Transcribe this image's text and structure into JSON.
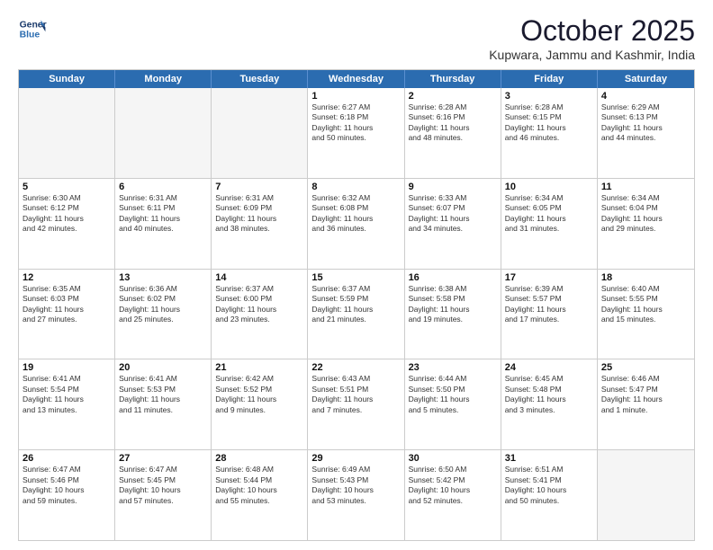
{
  "header": {
    "logo_line1": "General",
    "logo_line2": "Blue",
    "month": "October 2025",
    "location": "Kupwara, Jammu and Kashmir, India"
  },
  "weekdays": [
    "Sunday",
    "Monday",
    "Tuesday",
    "Wednesday",
    "Thursday",
    "Friday",
    "Saturday"
  ],
  "rows": [
    [
      {
        "day": "",
        "text": ""
      },
      {
        "day": "",
        "text": ""
      },
      {
        "day": "",
        "text": ""
      },
      {
        "day": "1",
        "text": "Sunrise: 6:27 AM\nSunset: 6:18 PM\nDaylight: 11 hours\nand 50 minutes."
      },
      {
        "day": "2",
        "text": "Sunrise: 6:28 AM\nSunset: 6:16 PM\nDaylight: 11 hours\nand 48 minutes."
      },
      {
        "day": "3",
        "text": "Sunrise: 6:28 AM\nSunset: 6:15 PM\nDaylight: 11 hours\nand 46 minutes."
      },
      {
        "day": "4",
        "text": "Sunrise: 6:29 AM\nSunset: 6:13 PM\nDaylight: 11 hours\nand 44 minutes."
      }
    ],
    [
      {
        "day": "5",
        "text": "Sunrise: 6:30 AM\nSunset: 6:12 PM\nDaylight: 11 hours\nand 42 minutes."
      },
      {
        "day": "6",
        "text": "Sunrise: 6:31 AM\nSunset: 6:11 PM\nDaylight: 11 hours\nand 40 minutes."
      },
      {
        "day": "7",
        "text": "Sunrise: 6:31 AM\nSunset: 6:09 PM\nDaylight: 11 hours\nand 38 minutes."
      },
      {
        "day": "8",
        "text": "Sunrise: 6:32 AM\nSunset: 6:08 PM\nDaylight: 11 hours\nand 36 minutes."
      },
      {
        "day": "9",
        "text": "Sunrise: 6:33 AM\nSunset: 6:07 PM\nDaylight: 11 hours\nand 34 minutes."
      },
      {
        "day": "10",
        "text": "Sunrise: 6:34 AM\nSunset: 6:05 PM\nDaylight: 11 hours\nand 31 minutes."
      },
      {
        "day": "11",
        "text": "Sunrise: 6:34 AM\nSunset: 6:04 PM\nDaylight: 11 hours\nand 29 minutes."
      }
    ],
    [
      {
        "day": "12",
        "text": "Sunrise: 6:35 AM\nSunset: 6:03 PM\nDaylight: 11 hours\nand 27 minutes."
      },
      {
        "day": "13",
        "text": "Sunrise: 6:36 AM\nSunset: 6:02 PM\nDaylight: 11 hours\nand 25 minutes."
      },
      {
        "day": "14",
        "text": "Sunrise: 6:37 AM\nSunset: 6:00 PM\nDaylight: 11 hours\nand 23 minutes."
      },
      {
        "day": "15",
        "text": "Sunrise: 6:37 AM\nSunset: 5:59 PM\nDaylight: 11 hours\nand 21 minutes."
      },
      {
        "day": "16",
        "text": "Sunrise: 6:38 AM\nSunset: 5:58 PM\nDaylight: 11 hours\nand 19 minutes."
      },
      {
        "day": "17",
        "text": "Sunrise: 6:39 AM\nSunset: 5:57 PM\nDaylight: 11 hours\nand 17 minutes."
      },
      {
        "day": "18",
        "text": "Sunrise: 6:40 AM\nSunset: 5:55 PM\nDaylight: 11 hours\nand 15 minutes."
      }
    ],
    [
      {
        "day": "19",
        "text": "Sunrise: 6:41 AM\nSunset: 5:54 PM\nDaylight: 11 hours\nand 13 minutes."
      },
      {
        "day": "20",
        "text": "Sunrise: 6:41 AM\nSunset: 5:53 PM\nDaylight: 11 hours\nand 11 minutes."
      },
      {
        "day": "21",
        "text": "Sunrise: 6:42 AM\nSunset: 5:52 PM\nDaylight: 11 hours\nand 9 minutes."
      },
      {
        "day": "22",
        "text": "Sunrise: 6:43 AM\nSunset: 5:51 PM\nDaylight: 11 hours\nand 7 minutes."
      },
      {
        "day": "23",
        "text": "Sunrise: 6:44 AM\nSunset: 5:50 PM\nDaylight: 11 hours\nand 5 minutes."
      },
      {
        "day": "24",
        "text": "Sunrise: 6:45 AM\nSunset: 5:48 PM\nDaylight: 11 hours\nand 3 minutes."
      },
      {
        "day": "25",
        "text": "Sunrise: 6:46 AM\nSunset: 5:47 PM\nDaylight: 11 hours\nand 1 minute."
      }
    ],
    [
      {
        "day": "26",
        "text": "Sunrise: 6:47 AM\nSunset: 5:46 PM\nDaylight: 10 hours\nand 59 minutes."
      },
      {
        "day": "27",
        "text": "Sunrise: 6:47 AM\nSunset: 5:45 PM\nDaylight: 10 hours\nand 57 minutes."
      },
      {
        "day": "28",
        "text": "Sunrise: 6:48 AM\nSunset: 5:44 PM\nDaylight: 10 hours\nand 55 minutes."
      },
      {
        "day": "29",
        "text": "Sunrise: 6:49 AM\nSunset: 5:43 PM\nDaylight: 10 hours\nand 53 minutes."
      },
      {
        "day": "30",
        "text": "Sunrise: 6:50 AM\nSunset: 5:42 PM\nDaylight: 10 hours\nand 52 minutes."
      },
      {
        "day": "31",
        "text": "Sunrise: 6:51 AM\nSunset: 5:41 PM\nDaylight: 10 hours\nand 50 minutes."
      },
      {
        "day": "",
        "text": ""
      }
    ]
  ]
}
